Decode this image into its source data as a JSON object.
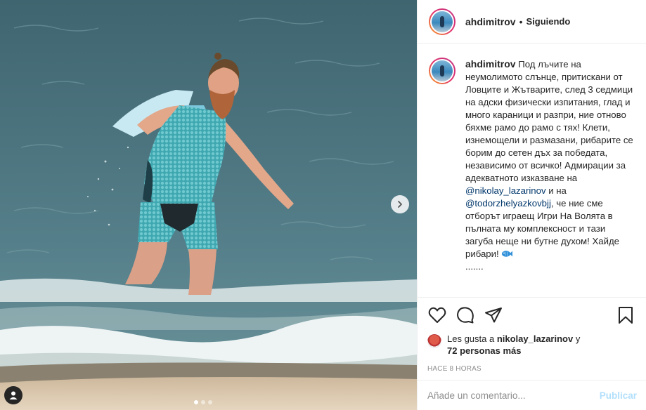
{
  "post": {
    "username": "ahdimitrov",
    "separator": "•",
    "follow_label": "Siguiendo",
    "carousel_total": 3,
    "carousel_active": 1
  },
  "caption": {
    "username": "ahdimitrov",
    "text_1": "Под лъчите на неумолимото слънце, притискани от Ловците и Жътварите, след 3 седмици на адски физически изпитания, глад и много караници и разпри, ние отново бяхме рамо до рамо с тях! Клети, изнемощели и размазани, рибарите се борим до сетен дъх за победата, независимо от всичко! Адмирации за адекватното изказване на ",
    "mention_1": "@nikolay_lazarinov",
    "text_2": " и на ",
    "mention_2": "@todorzhelyazkovbjj",
    "text_3": ", че ние сме отборът играещ Игри На Волята в пълната му комплексност и тази загуба неще ни бутне духом! Хайде рибари!",
    "emoji": "fish-icon",
    "more": "......."
  },
  "likes": {
    "prefix": "Les gusta a ",
    "user": "nikolay_lazarinov",
    "joiner": " y",
    "others": "72 personas más"
  },
  "time": "HACE 8 HORAS",
  "comment": {
    "placeholder": "Añade un comentario...",
    "publish_label": "Publicar"
  },
  "icons": [
    "heart-icon",
    "comment-icon",
    "share-icon",
    "bookmark-icon",
    "user-tag-icon",
    "chevron-right-icon"
  ],
  "colors": {
    "mention": "#00376b",
    "publish_disabled": "#b2dffc",
    "muted": "#8e8e8e",
    "text": "#262626"
  }
}
